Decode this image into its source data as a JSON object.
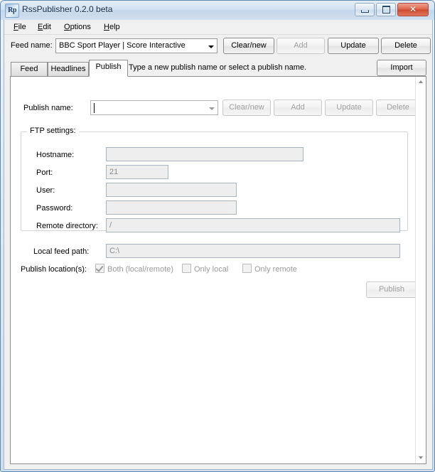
{
  "window": {
    "title": "RssPublisher 0.2.0 beta",
    "icon_label": "Rp",
    "icon_name": "app-icon-rp",
    "controls": {
      "minimize": "minimize-icon",
      "maximize": "maximize-icon",
      "close": "✕"
    }
  },
  "menubar": {
    "items": [
      {
        "label": "File",
        "mnemonic": "F"
      },
      {
        "label": "Edit",
        "mnemonic": "E"
      },
      {
        "label": "Options",
        "mnemonic": "O"
      },
      {
        "label": "Help",
        "mnemonic": "H"
      }
    ]
  },
  "feed_row": {
    "label": "Feed name:",
    "combo_value": "BBC Sport Player | Score Interactive",
    "buttons": [
      {
        "label": "Clear/new",
        "enabled": true
      },
      {
        "label": "Add",
        "enabled": false
      },
      {
        "label": "Update",
        "enabled": true
      },
      {
        "label": "Delete",
        "enabled": true
      }
    ]
  },
  "tabs": {
    "items": [
      {
        "label": "Feed",
        "active": false
      },
      {
        "label": "Headlines",
        "active": false
      },
      {
        "label": "Publish",
        "active": true
      }
    ],
    "hint": "Type a new publish name or select a publish name.",
    "import_label": "Import"
  },
  "publish_tab": {
    "publish_name": {
      "label": "Publish name:",
      "value": "",
      "buttons": [
        {
          "label": "Clear/new",
          "enabled": false
        },
        {
          "label": "Add",
          "enabled": false
        },
        {
          "label": "Update",
          "enabled": false
        },
        {
          "label": "Delete",
          "enabled": false
        }
      ]
    },
    "ftp_settings": {
      "legend": "FTP settings:",
      "fields": [
        {
          "label": "Hostname:",
          "value": ""
        },
        {
          "label": "Port:",
          "value": "21"
        },
        {
          "label": "User:",
          "value": ""
        },
        {
          "label": "Password:",
          "value": ""
        },
        {
          "label": "Remote directory:",
          "value": "/"
        }
      ]
    },
    "local_feed_path": {
      "label": "Local feed path:",
      "value": "C:\\"
    },
    "publish_locations": {
      "label": "Publish location(s):",
      "options": [
        {
          "label": "Both (local/remote)",
          "checked": true
        },
        {
          "label": "Only local",
          "checked": false
        },
        {
          "label": "Only remote",
          "checked": false
        }
      ]
    },
    "publish_button": {
      "label": "Publish",
      "enabled": false
    }
  },
  "colors": {
    "title_accent": "#c3d6e9",
    "close_button": "#cf4a30",
    "frame_border": "#5b8bb5",
    "disabled_text": "#a0a0a0"
  }
}
